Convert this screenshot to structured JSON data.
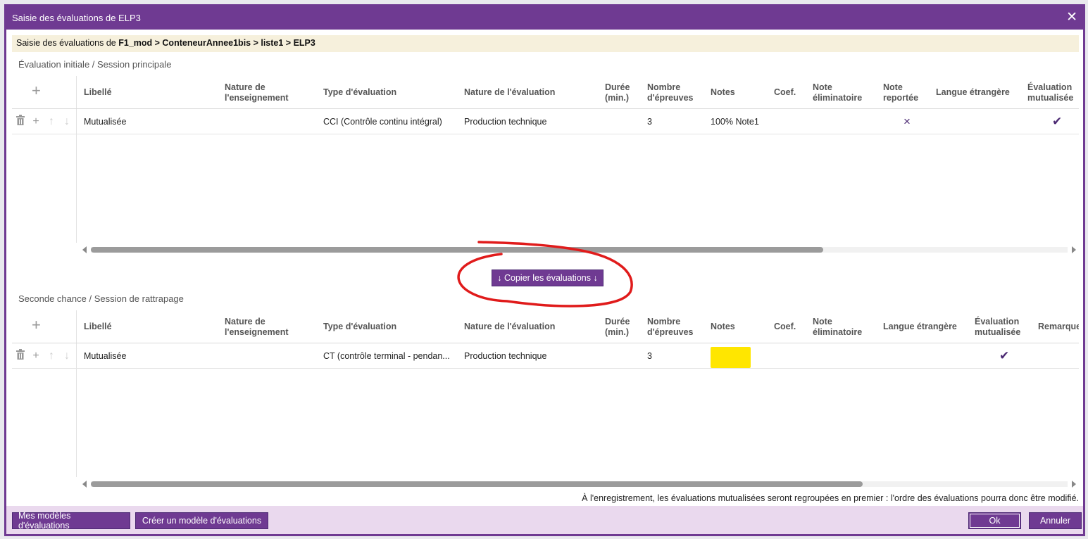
{
  "window": {
    "title": "Saisie des évaluations de ELP3",
    "close_label": "✕"
  },
  "breadcrumb": {
    "prefix": "Saisie des évaluations de ",
    "path": "F1_mod > ConteneurAnnee1bis > liste1 > ELP3"
  },
  "session1": {
    "title": "Évaluation initiale / Session principale",
    "add_label": "+",
    "headers": {
      "libelle": "Libellé",
      "nature_ens_1": "Nature de",
      "nature_ens_2": "l'enseignement",
      "type_eval": "Type d'évaluation",
      "nature_eval": "Nature de l'évaluation",
      "duree_1": "Durée",
      "duree_2": "(min.)",
      "nb_epreuves_1": "Nombre",
      "nb_epreuves_2": "d'épreuves",
      "notes": "Notes",
      "coef": "Coef.",
      "note_elim_1": "Note",
      "note_elim_2": "éliminatoire",
      "note_rep_1": "Note",
      "note_rep_2": "reportée",
      "langue": "Langue étrangère",
      "eval_mut_1": "Évaluation",
      "eval_mut_2": "mutualisée"
    },
    "row": {
      "libelle": "Mutualisée",
      "nature_ens": "",
      "type_eval": "CCI (Contrôle continu intégral)",
      "nature_eval": "Production technique",
      "duree": "",
      "nb_epreuves": "3",
      "notes": "100% Note1",
      "coef": "",
      "note_elim": "",
      "note_rep": "×",
      "langue": "",
      "eval_mut": "✔"
    },
    "scroll_fraction": 0.75
  },
  "copy_button": {
    "label": "↓ Copier les évaluations ↓"
  },
  "session2": {
    "title": "Seconde chance / Session de rattrapage",
    "add_label": "+",
    "headers": {
      "libelle": "Libellé",
      "nature_ens_1": "Nature de",
      "nature_ens_2": "l'enseignement",
      "type_eval": "Type d'évaluation",
      "nature_eval": "Nature de l'évaluation",
      "duree_1": "Durée",
      "duree_2": "(min.)",
      "nb_epreuves_1": "Nombre",
      "nb_epreuves_2": "d'épreuves",
      "notes": "Notes",
      "coef": "Coef.",
      "note_elim_1": "Note",
      "note_elim_2": "éliminatoire",
      "langue": "Langue étrangère",
      "eval_mut_1": "Évaluation",
      "eval_mut_2": "mutualisée",
      "remarque": "Remarque"
    },
    "row": {
      "libelle": "Mutualisée",
      "nature_ens": "",
      "type_eval": "CT (contrôle terminal - pendan...",
      "nature_eval": "Production technique",
      "duree": "",
      "nb_epreuves": "3",
      "notes": "",
      "coef": "",
      "note_elim": "",
      "langue": "",
      "eval_mut": "✔"
    },
    "scroll_fraction": 0.79
  },
  "footer": {
    "note": "À l'enregistrement, les évaluations mutualisées seront regroupées en premier : l'ordre des évaluations pourra donc être modifié.",
    "models_button": "Mes modèles d'évaluations",
    "create_model_button": "Créer un modèle d'évaluations",
    "ok_button": "Ok",
    "cancel_button": "Annuler"
  },
  "icons": {
    "trash": "trash-icon",
    "plus": "plus-icon",
    "arrow_up": "arrow-up-icon",
    "arrow_down": "arrow-down-icon"
  },
  "colors": {
    "primary": "#6f3a92",
    "footer_bg": "#ead9ee",
    "breadcrumb_bg": "#f6f0dc",
    "annotation_red": "#e01b1b",
    "highlight_yellow": "#ffe600"
  }
}
